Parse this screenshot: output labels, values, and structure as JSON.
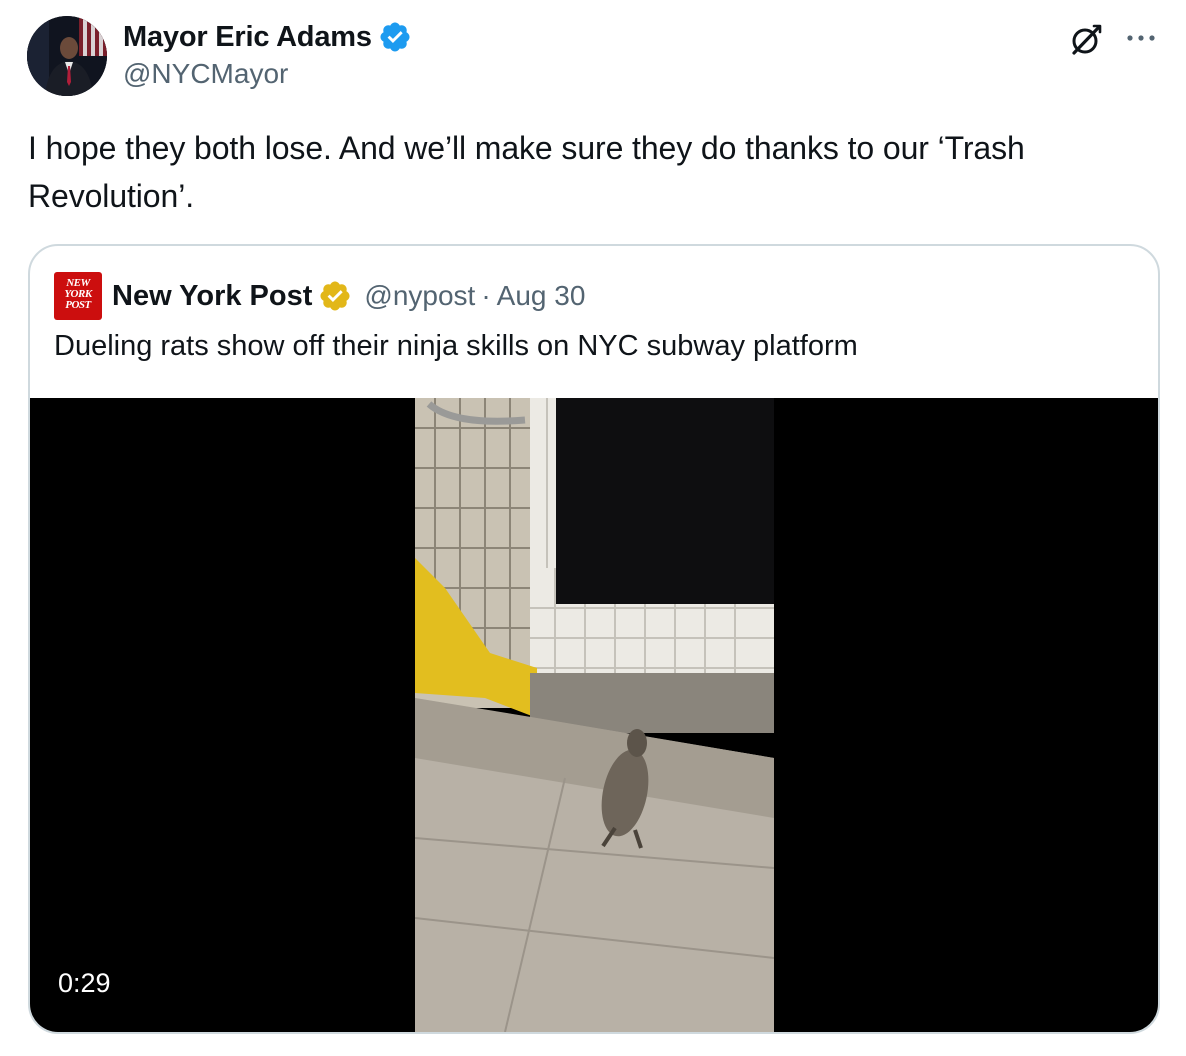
{
  "author": {
    "name": "Mayor Eric Adams",
    "handle": "@NYCMayor",
    "verified_color": "#1d9bf0"
  },
  "icons": {
    "verified": "verified-badge-icon",
    "grok": "grok-icon",
    "more": "more-icon"
  },
  "tweet": {
    "text": "I hope they both lose. And we’ll make sure they do thanks to our ‘Trash Revolution’."
  },
  "quote": {
    "author_name": "New York Post",
    "handle": "@nypost",
    "separator": "·",
    "date": "Aug 30",
    "text": "Dueling rats show off their ninja skills on NYC subway platform",
    "logo_lines": [
      "NEW",
      "YORK",
      "POST"
    ],
    "logo_color": "#cc0e0e",
    "verified_color": "#e2b719",
    "media": {
      "type": "video",
      "duration": "0:29"
    }
  },
  "colors": {
    "text_primary": "#0f1419",
    "text_secondary": "#536471",
    "border": "#cfd9de"
  }
}
